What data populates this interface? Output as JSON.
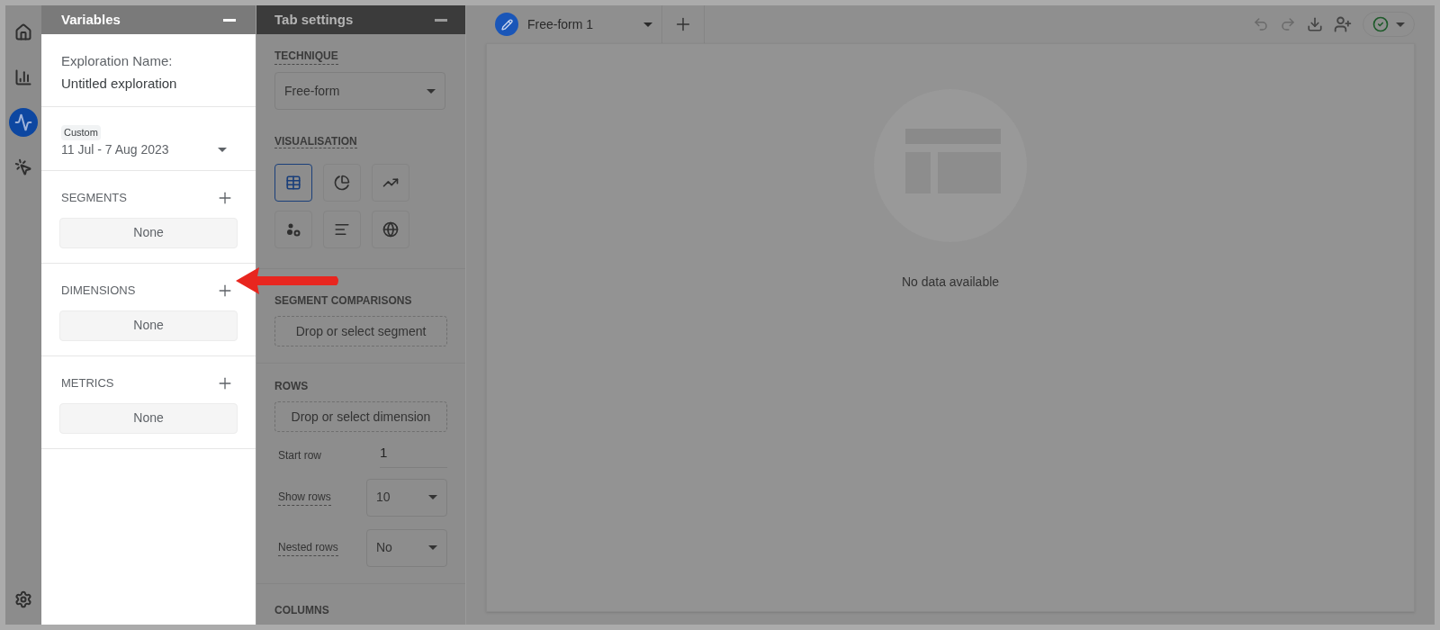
{
  "nav_rail": {
    "items": [
      {
        "kind": "home",
        "selected": false
      },
      {
        "kind": "reports",
        "selected": false
      },
      {
        "kind": "explore",
        "selected": true
      },
      {
        "kind": "advertising",
        "selected": false
      }
    ],
    "bottom_items": [
      {
        "kind": "settings",
        "selected": false
      }
    ]
  },
  "variables_panel": {
    "title": "Variables",
    "exploration_name": {
      "label": "Exploration Name:",
      "value": "Untitled exploration"
    },
    "date_range": {
      "badge": "Custom",
      "value": "11 Jul - 7 Aug 2023"
    },
    "sections": [
      {
        "title": "SEGMENTS",
        "empty": "None"
      },
      {
        "title": "DIMENSIONS",
        "empty": "None"
      },
      {
        "title": "METRICS",
        "empty": "None"
      }
    ]
  },
  "tab_settings": {
    "title": "Tab settings",
    "technique": {
      "label": "TECHNIQUE",
      "value": "Free-form"
    },
    "visualisation": {
      "label": "VISUALISATION",
      "options": [
        {
          "kind": "table",
          "selected": true
        },
        {
          "kind": "donut",
          "selected": false
        },
        {
          "kind": "line",
          "selected": false
        },
        {
          "kind": "scatter",
          "selected": false
        },
        {
          "kind": "bar",
          "selected": false
        },
        {
          "kind": "geo",
          "selected": false
        }
      ]
    },
    "segment_comparisons": {
      "label": "SEGMENT COMPARISONS",
      "placeholder": "Drop or select segment"
    },
    "rows": {
      "label": "ROWS",
      "placeholder": "Drop or select dimension",
      "start_row": {
        "label": "Start row",
        "value": "1"
      },
      "show_rows": {
        "label": "Show rows",
        "value": "10"
      },
      "nested_rows": {
        "label": "Nested rows",
        "value": "No"
      }
    },
    "columns": {
      "label": "COLUMNS"
    }
  },
  "canvas": {
    "tabs": [
      {
        "label": "Free-form 1",
        "selected": true
      }
    ],
    "empty_state": "No data available"
  }
}
